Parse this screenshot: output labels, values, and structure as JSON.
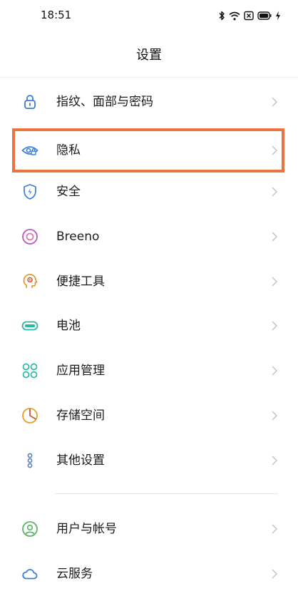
{
  "status_bar": {
    "time": "18:51",
    "icons": [
      "bluetooth-icon",
      "wifi-icon",
      "sim-off-icon",
      "battery-icon",
      "charging-icon"
    ]
  },
  "header": {
    "title": "设置"
  },
  "settings": {
    "items": [
      {
        "label": "指纹、面部与密码",
        "icon": "lock-icon",
        "color": "#3b7dd8"
      },
      {
        "label": "隐私",
        "icon": "privacy-eye-icon",
        "color": "#3b7dd8"
      },
      {
        "label": "安全",
        "icon": "security-shield-icon",
        "color": "#3b7dd8"
      },
      {
        "label": "Breeno",
        "icon": "breeno-icon",
        "color": "#b65cc4"
      },
      {
        "label": "便捷工具",
        "icon": "tools-icon",
        "color": "#e39a2d"
      },
      {
        "label": "电池",
        "icon": "battery-settings-icon",
        "color": "#27b9a6"
      },
      {
        "label": "应用管理",
        "icon": "apps-icon",
        "color": "#27b9a6"
      },
      {
        "label": "存储空间",
        "icon": "storage-icon",
        "color": "#e8a12f"
      },
      {
        "label": "其他设置",
        "icon": "more-settings-icon",
        "color": "#5b7fb8"
      },
      {
        "label": "用户与帐号",
        "icon": "user-account-icon",
        "color": "#5db36a"
      },
      {
        "label": "云服务",
        "icon": "cloud-icon",
        "color": "#3b7dd8"
      }
    ]
  },
  "highlight": {
    "color": "#ea7440"
  }
}
